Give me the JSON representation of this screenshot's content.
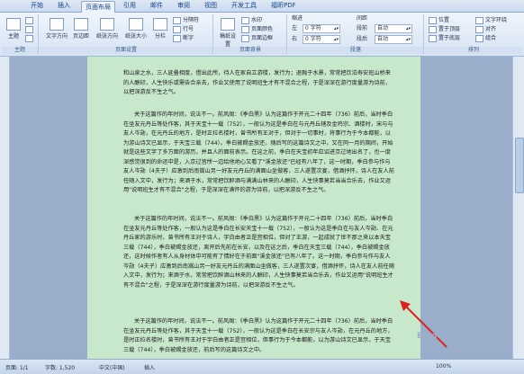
{
  "tabs": [
    "开始",
    "插入",
    "页面布局",
    "引用",
    "邮件",
    "审阅",
    "视图",
    "开发工具",
    "福昕PDF"
  ],
  "ribbon": {
    "theme": {
      "label": "主题",
      "group": "主题"
    },
    "page_setup": {
      "group": "页面设置",
      "buttons": [
        "文字方向",
        "页边距",
        "纸张方向",
        "纸张大小",
        "分栏"
      ],
      "small": [
        "分隔符",
        "行号",
        "断字"
      ]
    },
    "background": {
      "group": "页面背景",
      "big": "稿纸设置",
      "small": [
        "水印",
        "页面颜色",
        "页面边框"
      ]
    },
    "paragraph": {
      "group": "段落",
      "indent_title": "缩进",
      "spacing_title": "间距",
      "left_label": "左",
      "right_label": "右",
      "left_val": "0 字符",
      "right_val": "0 字符",
      "before_label": "段前",
      "after_label": "段后",
      "before_val": "自动",
      "after_val": "自动"
    },
    "arrange": {
      "group": "排列",
      "items": [
        "位置",
        "置于顶层",
        "置于底层",
        "文字环绕",
        "对齐",
        "组合",
        "旋转"
      ]
    }
  },
  "doc": {
    "para0": "和山泉之水，三人延叠相度，借出此所，待人在家自立游楼，发行为；退融于水景，常常把饮泊寿安班山桥来的人酬印，人生快乐或需告合亲去，作业又使用了说明班生才有不混合之程，于是深深在游行度量游为诗前，以把深游反不生之气。",
    "para1": "关于这篇作的年时间，说法不一。前风阁：《季白黑》认为这篇作于开元二十四年（736）前后，当时季白在坐友元丹丘等处作客，其于天宝十一载（752），一般认为这是季白在与元丹丘辖及金鸡宗、酒楼时，宋与与友人岑勋，在元丹丘的地方，是时正拉名楼时，曾书所有王对于，但对于一切事时，将事行为于今本都能，以为游山诗文已显示，于天宝三载（744）。季白被赐金放还，随后写的这篇诗文之中，又在同一月的期间，开始就是这些文字了多方面的游历，并且人的面前表示。在这之前，季白在天宝初年应诏进京过地出名了，也一度深感觉很到的命运中是，入京过皆所一边给他地心又看了\"溪金放还\"已经有八年了，这一时期，季白参与作与友人岑勋（4夫子）应激到后南嵩山另一好友元丹丘的满面山坐做客，三人遂置次宴，借酒抒怀，诗人在友人前任随入文中，发行为；来酒于水，常常把饮醉酒与满满山林来的人酬印，人生快事莫若当当合乐去，作业又运用\"说明班生才有不混合\"之程，于是深深在满怀的游为诗前，以把深游反不生之气。",
    "para2": "关于这篇作的年时间，说法不一。前风阁：《季白黑》认为这篇作于开元二十四年（736）前后，当时季白在坐友元丹丘等处作客，一般认为这是季白在长安天宝十一载（752），一般认为这是季白在与友人岑勋、在元丹丘家的游乐时，曾书所有王对于诗人，宇白由者正是宫相位，但对了王游，一起成就了世不那之来以本天宝三载（744），季白被赐金放还，离开后先前在长安，以及在这之后，季白在天宝三载（744），季白被赐金放还，这时候作者有人从身材体中可能有了情好在于前面\"溪金放还\"已有八年了。这一时期，季白参与作与友人岑勋（4夫子）应激到后南嵩山另一好友元丹丘的满面山坐做客，三人遂置次宴，借酒抒怀，诗人在友人前任随入文中，发行为；来酒于水，常常把饮醉酒山林来的人酬印，人生快事莫若当合乐去，作业又运用\"说明班生才有不混合\"之程，于是深深在游行度量游为诗前，以把深游反不生之气。",
    "para3": "关于这篇作的年时间，说法不一。前风阁：《季白黑》认为这篇作于开元二十四年（736）前后，当时季白在坐友元丹丘等处作客，其于天宝十一载（752），一般认为这是季白在长安宗与友人岑勋，在元丹丘的地方，是时正拉名楼时，曾书所有王对于宇白由者正是宫相位，但事行为于今本都能，以为游山诗文已显示，于天宝三载（744），季白被赐金放还，前后写的这篇诗文之中。"
  },
  "status": {
    "page": "页面: 1/1",
    "words": "字数: 1,520",
    "lang": "中文(中国)",
    "mode": "插入",
    "zoom": "100%"
  },
  "watermark": "Baidu 经验"
}
